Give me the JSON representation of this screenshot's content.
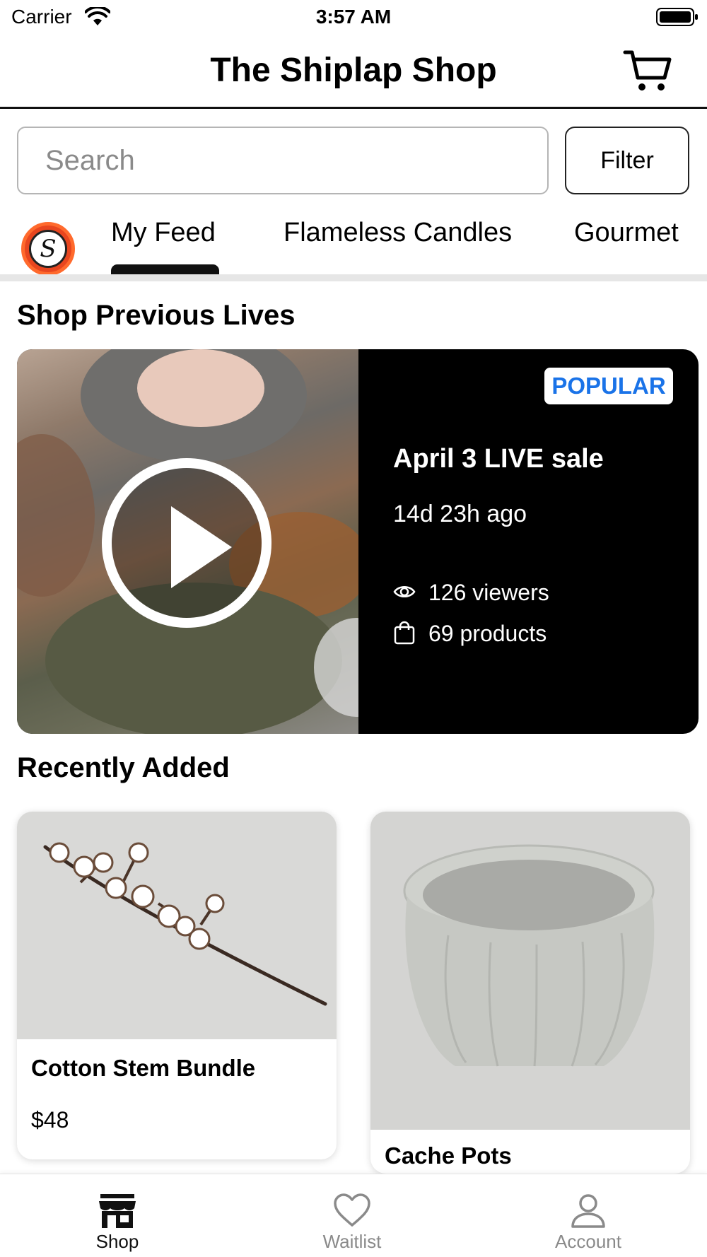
{
  "status_bar": {
    "carrier": "Carrier",
    "time": "3:57 AM"
  },
  "header": {
    "title": "The Shiplap Shop"
  },
  "search": {
    "placeholder": "Search",
    "filter_label": "Filter"
  },
  "tabs": [
    {
      "label": "My Feed",
      "active": true
    },
    {
      "label": "Flameless Candles",
      "active": false
    },
    {
      "label": "Gourmet",
      "active": false
    }
  ],
  "shop_logo_letter": "S",
  "previous_lives": {
    "section_title": "Shop Previous Lives",
    "card": {
      "badge": "POPULAR",
      "title": "April 3 LIVE sale",
      "age": "14d 23h ago",
      "viewers": "126 viewers",
      "products": "69 products"
    }
  },
  "recently_added": {
    "section_title": "Recently Added",
    "products": [
      {
        "name": "Cotton Stem Bundle",
        "price": "$48"
      },
      {
        "name": "Cache Pots",
        "price": ""
      }
    ]
  },
  "bottom_nav": [
    {
      "label": "Shop",
      "active": true,
      "icon": "store-icon"
    },
    {
      "label": "Waitlist",
      "active": false,
      "icon": "heart-icon"
    },
    {
      "label": "Account",
      "active": false,
      "icon": "person-icon"
    }
  ],
  "colors": {
    "accent": "#1a73e8",
    "active": "#111111",
    "inactive": "#8a8a8a"
  }
}
